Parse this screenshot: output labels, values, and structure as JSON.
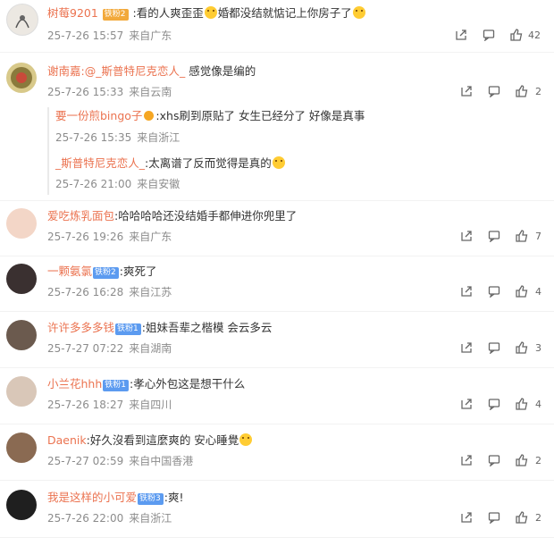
{
  "comments": [
    {
      "user": "树莓9201",
      "badge": "铁粉2",
      "badge_style": "gold",
      "text": ":看的人爽歪歪",
      "text2": "婚都没结就惦记上你房子了",
      "date": "25-7-26 15:57",
      "loc": "来自广东",
      "likes": "42"
    },
    {
      "user": "谢南嘉",
      "reply_prefix": ":@_斯普特尼克恋人_",
      "text": " 感觉像是编的",
      "date": "25-7-26 15:33",
      "loc": "来自云南",
      "likes": "2",
      "replies": [
        {
          "user": "要一份煎bingo子",
          "text": ":xhs刷到原贴了 女生已经分了 好像是真事",
          "date": "25-7-26 15:35",
          "loc": "来自浙江"
        },
        {
          "user": "_斯普特尼克恋人_",
          "text": ":太离谱了反而觉得是真的",
          "date": "25-7-26 21:00",
          "loc": "来自安徽"
        }
      ]
    },
    {
      "user": "爱吃炼乳面包",
      "text": ":哈哈哈哈还没结婚手都伸进你兜里了",
      "date": "25-7-26 19:26",
      "loc": "来自广东",
      "likes": "7"
    },
    {
      "user": "一颗氨氯",
      "badge": "铁粉2",
      "badge_style": "blue",
      "text": ":爽死了",
      "date": "25-7-26 16:28",
      "loc": "来自江苏",
      "likes": "4"
    },
    {
      "user": "许许多多多钱",
      "badge": "铁粉1",
      "badge_style": "blue",
      "text": ":姐妹吾辈之楷模 会云多云",
      "date": "25-7-27 07:22",
      "loc": "来自湖南",
      "likes": "3"
    },
    {
      "user": "小兰花hhh",
      "badge": "铁粉1",
      "badge_style": "blue",
      "text": ":孝心外包这是想干什么",
      "date": "25-7-26 18:27",
      "loc": "来自四川",
      "likes": "4"
    },
    {
      "user": "Daenik",
      "text": ":好久沒看到這麼爽的 安心睡覺",
      "date": "25-7-27 02:59",
      "loc": "来自中国香港",
      "likes": "2"
    },
    {
      "user": "我是这样的小可爱",
      "badge": "铁粉3",
      "badge_style": "blue",
      "text": ":爽!",
      "date": "25-7-26 22:00",
      "loc": "来自浙江",
      "likes": "2"
    }
  ],
  "avatar_colors": [
    "#e9e4dc",
    "#d8c98a",
    "#f3d6c7",
    "#3a3030",
    "#6b5a4e",
    "#d9c7b8",
    "#8a6a52",
    "#1f1f1f"
  ]
}
